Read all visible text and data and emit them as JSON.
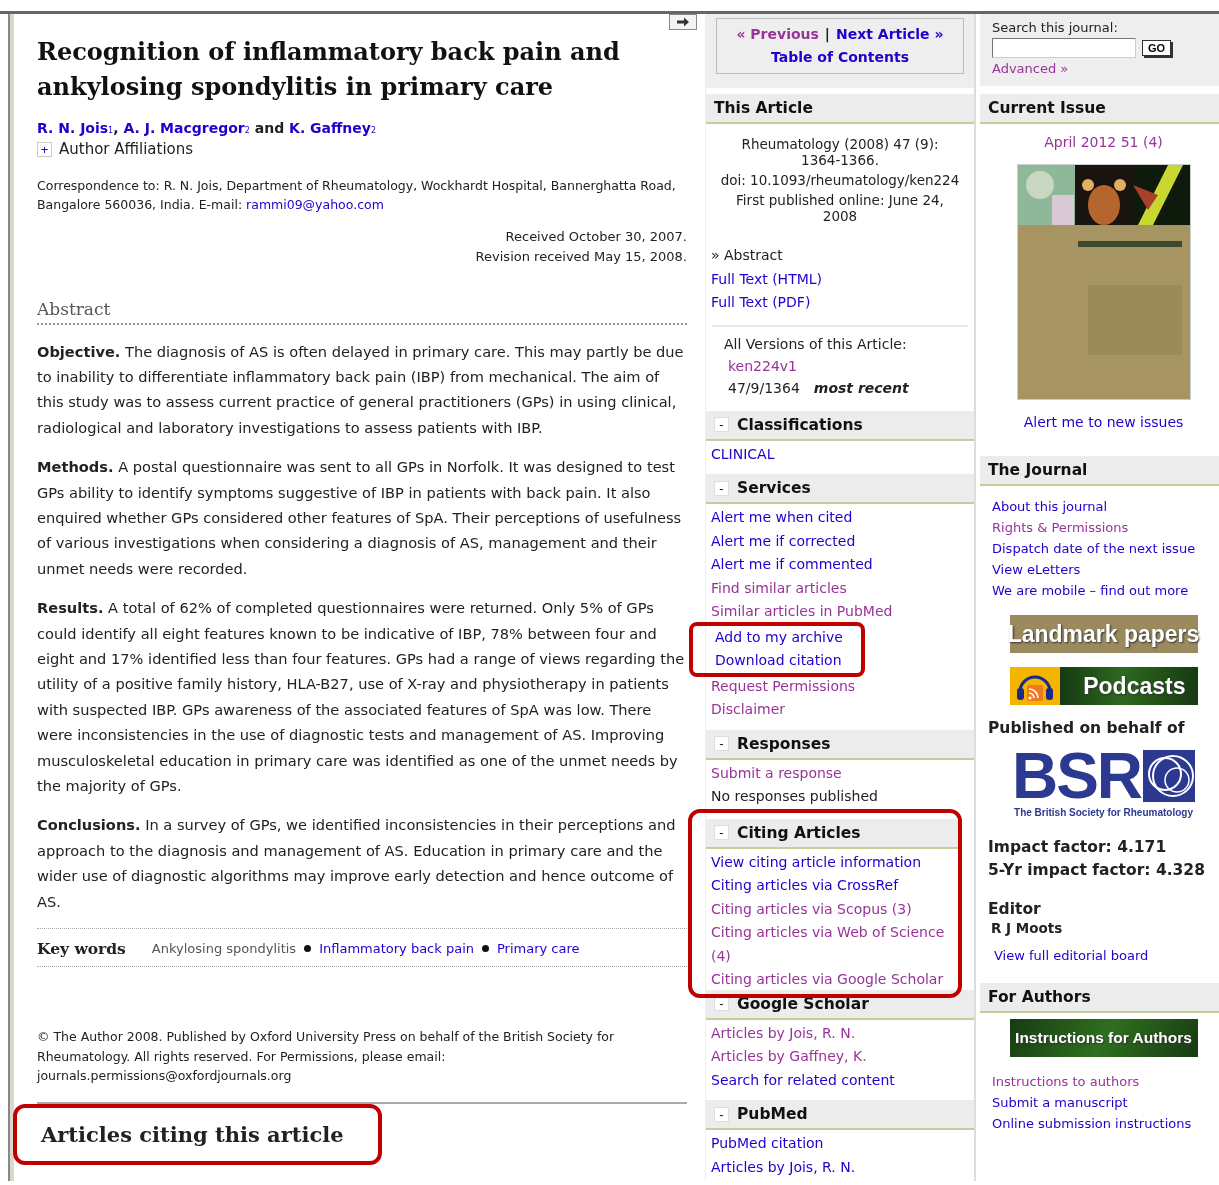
{
  "article": {
    "title": "Recognition of inflammatory back pain and ankylosing spondylitis in primary care",
    "authors": [
      {
        "name": "R. N. Jois",
        "sup": "1"
      },
      {
        "separator": ", ",
        "name": "A. J. Macgregor",
        "sup": "2"
      },
      {
        "separator": " and ",
        "name": "K. Gaffney",
        "sup": "2"
      }
    ],
    "affiliations": {
      "toggle": "+",
      "label": "Author Affiliations"
    },
    "correspondence": {
      "text": "Correspondence to: R. N. Jois, Department of Rheumatology, Wockhardt Hospital, Bannerghatta Road, Bangalore 560036, India. E-mail:",
      "email": "rammi09@yahoo.com"
    },
    "dates": [
      "Received October 30, 2007.",
      "Revision received May 15, 2008."
    ],
    "abstract": {
      "heading": "Abstract",
      "sections": [
        {
          "label": "Objective.",
          "text": "The diagnosis of AS is often delayed in primary care. This may partly be due to inability to differentiate inflammatory back pain (IBP) from mechanical. The aim of this study was to assess current practice of general practitioners (GPs) in using clinical, radiological and laboratory investigations to assess patients with IBP."
        },
        {
          "label": "Methods.",
          "text": "A postal questionnaire was sent to all GPs in Norfolk. It was designed to test GPs ability to identify symptoms suggestive of IBP in patients with back pain. It also enquired whether GPs considered other features of SpA. Their perceptions of usefulness of various investigations when considering a diagnosis of AS, management and their unmet needs were recorded."
        },
        {
          "label": "Results.",
          "text": "A total of 62% of completed questionnaires were returned. Only 5% of GPs could identify all eight features known to be indicative of IBP, 78% between four and eight and 17% identified less than four features. GPs had a range of views regarding the utility of a positive family history, HLA-B27, use of X-ray and physiotherapy in patients with suspected IBP. GPs awareness of the associated features of SpA was low. There were inconsistencies in the use of diagnostic tests and management of AS. Improving musculoskeletal education in primary care was identified as one of the unmet needs by the majority of GPs."
        },
        {
          "label": "Conclusions.",
          "text": "In a survey of GPs, we identified inconsistencies in their perceptions and approach to the diagnosis and management of AS. Education in primary care and the wider use of diagnostic algorithms may improve early detection and hence outcome of AS."
        }
      ]
    },
    "keywords": {
      "heading": "Key words",
      "items": [
        {
          "text": "Ankylosing spondylitis",
          "kind": "text"
        },
        {
          "text": "Inflammatory back pain",
          "kind": "link"
        },
        {
          "text": "Primary care",
          "kind": "link"
        }
      ]
    },
    "copyright": "© The Author 2008. Published by Oxford University Press on behalf of the British Society for Rheumatology. All rights reserved. For Permissions, please email: journals.permissions@oxfordjournals.org",
    "citing_heading": {
      "text": "Articles citing this article",
      "highlighted": true
    }
  },
  "sidebar": {
    "nav": {
      "links": [
        {
          "text": "« Previous",
          "visited": true
        },
        {
          "text": "Next Article »",
          "visited": false
        }
      ],
      "separator": "|",
      "toc": {
        "text": "Table of Contents",
        "visited": false
      }
    },
    "this_article": {
      "heading": "This Article",
      "citation": [
        "Rheumatology (2008) 47 (9): 1364-1366.",
        "doi: 10.1093/rheumatology/ken224",
        "First published online: June 24, 2008"
      ],
      "links": [
        {
          "text": "» Abstract",
          "kind": "current"
        },
        {
          "text": "Full Text (HTML)",
          "kind": "link",
          "visited": false
        },
        {
          "text": "Full Text (PDF)",
          "kind": "link",
          "visited": false
        }
      ],
      "versions": {
        "label": "All Versions of this Article:",
        "version": {
          "text": "ken224v1",
          "visited": true
        },
        "latest": "47/9/1364",
        "latest_note": "most recent"
      }
    },
    "sections": [
      {
        "title": "Classifications",
        "toggle": "-",
        "items": [
          {
            "text": "CLINICAL",
            "kind": "link",
            "visited": false
          }
        ]
      },
      {
        "title": "Services",
        "toggle": "-",
        "items": [
          {
            "text": "Alert me when cited",
            "kind": "link",
            "visited": false
          },
          {
            "text": "Alert me if corrected",
            "kind": "link",
            "visited": false
          },
          {
            "text": "Alert me if commented",
            "kind": "link",
            "visited": false
          },
          {
            "text": "Find similar articles",
            "kind": "link",
            "visited": true
          },
          {
            "text": "Similar articles in PubMed",
            "kind": "link",
            "visited": true
          },
          {
            "text": "Add to my archive",
            "kind": "link",
            "visited": false,
            "highlighted": true
          },
          {
            "text": "Download citation",
            "kind": "link",
            "visited": false,
            "highlighted": true
          },
          {
            "text": "Request Permissions",
            "kind": "link",
            "visited": true
          },
          {
            "text": "Disclaimer",
            "kind": "link",
            "visited": true
          }
        ]
      },
      {
        "title": "Responses",
        "toggle": "-",
        "items": [
          {
            "text": "Submit a response",
            "kind": "link",
            "visited": true
          },
          {
            "text": "No responses published",
            "kind": "text"
          }
        ]
      },
      {
        "title": "Citing Articles",
        "toggle": "-",
        "highlighted": true,
        "items": [
          {
            "text": "View citing article information",
            "kind": "link",
            "visited": false
          },
          {
            "text": "Citing articles via CrossRef",
            "kind": "link",
            "visited": false
          },
          {
            "text": "Citing articles via Scopus (3)",
            "kind": "link",
            "visited": true
          },
          {
            "text": "Citing articles via Web of Science (4)",
            "kind": "link",
            "visited": true
          },
          {
            "text": "Citing articles via Google Scholar",
            "kind": "link",
            "visited": true
          }
        ]
      },
      {
        "title": "Google Scholar",
        "toggle": "-",
        "items": [
          {
            "text": "Articles by Jois, R. N.",
            "kind": "link",
            "visited": true
          },
          {
            "text": "Articles by Gaffney, K.",
            "kind": "link",
            "visited": true
          },
          {
            "text": "Search for related content",
            "kind": "link",
            "visited": false
          }
        ]
      },
      {
        "title": "PubMed",
        "toggle": "-",
        "items": [
          {
            "text": "PubMed citation",
            "kind": "link",
            "visited": false
          },
          {
            "text": "Articles by Jois, R. N.",
            "kind": "link",
            "visited": false
          }
        ]
      }
    ]
  },
  "rightbar": {
    "search": {
      "label": "Search this journal:",
      "button": "GO",
      "advanced": {
        "text": "Advanced »",
        "visited": true
      }
    },
    "current_issue": {
      "heading": "Current Issue",
      "issue": {
        "text": "April 2012 51 (4)",
        "visited": true
      },
      "alert": {
        "text": "Alert me to new issues",
        "visited": false
      }
    },
    "journal": {
      "heading": "The Journal",
      "links": [
        {
          "text": "About this journal",
          "visited": false
        },
        {
          "text": "Rights & Permissions",
          "visited": true
        },
        {
          "text": "Dispatch date of the next issue",
          "visited": false
        },
        {
          "text": "View eLetters",
          "visited": false
        },
        {
          "text": "We are mobile – find out more",
          "visited": false
        }
      ]
    },
    "banners": [
      {
        "text": "Landmark papers",
        "kind": "landmark"
      },
      {
        "text": "Podcasts",
        "kind": "podcast"
      }
    ],
    "publisher": {
      "label": "Published on behalf of",
      "logo": "BSR",
      "caption": "The British Society for Rheumatology"
    },
    "metrics": [
      "Impact factor: 4.171",
      "5-Yr impact factor: 4.328"
    ],
    "editor": {
      "heading": "Editor",
      "name": "R J Moots",
      "link": {
        "text": "View full editorial board",
        "visited": false
      }
    },
    "for_authors": {
      "heading": "For Authors",
      "banner": "Instructions for Authors",
      "links": [
        {
          "text": "Instructions to authors",
          "visited": true
        },
        {
          "text": "Submit a manuscript",
          "visited": false
        },
        {
          "text": "Online submission instructions",
          "visited": false
        }
      ]
    }
  }
}
